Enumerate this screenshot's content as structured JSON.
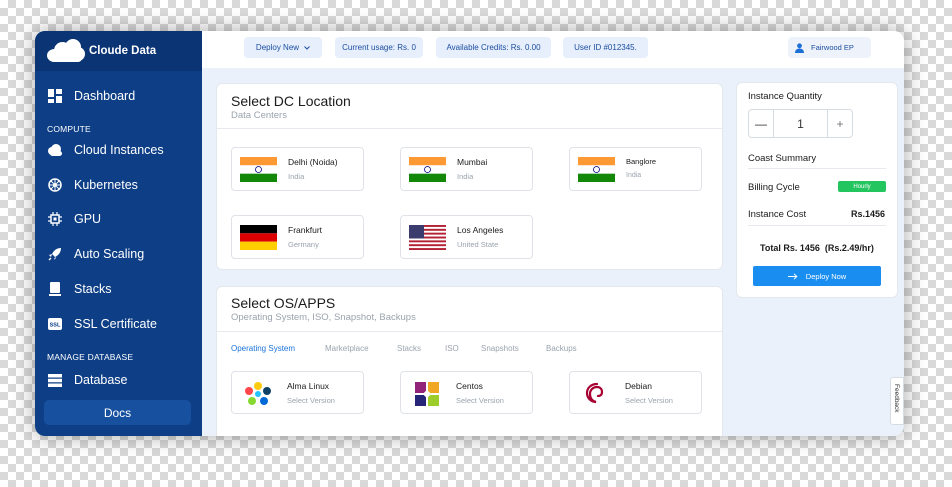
{
  "app": {
    "name": "Cloude Data"
  },
  "sidebar": {
    "items": [
      {
        "label": "Dashboard",
        "icon": "dashboard-icon"
      },
      {
        "label": "Cloud Instances",
        "icon": "cloud-icon"
      },
      {
        "label": "Kubernetes",
        "icon": "kubernetes-icon"
      },
      {
        "label": "GPU",
        "icon": "gpu-icon"
      },
      {
        "label": "Auto Scaling",
        "icon": "rocket-icon"
      },
      {
        "label": "Stacks",
        "icon": "stacks-icon"
      },
      {
        "label": "SSL Certificate",
        "icon": "ssl-icon"
      },
      {
        "label": "Database",
        "icon": "database-icon"
      }
    ],
    "sections": {
      "compute": "COMPUTE",
      "manage_database": "MANAGE DATABASE"
    },
    "docs_label": "Docs"
  },
  "topbar": {
    "deploy_label": "Deploy New",
    "usage": "Current usage: Rs. 0",
    "credits": "Available Credits: Rs. 0.00",
    "user_id": "User ID #012345.",
    "user_name": "Fairwood EP"
  },
  "dc": {
    "title": "Select DC Location",
    "subtitle": "Data Centers",
    "locations": [
      {
        "name": "Delhi (Noida)",
        "country": "India",
        "flag": "india"
      },
      {
        "name": "Mumbai",
        "country": "India",
        "flag": "india"
      },
      {
        "name": "Banglore",
        "country": "India",
        "flag": "india"
      },
      {
        "name": "Frankfurt",
        "country": "Germany",
        "flag": "germany"
      },
      {
        "name": "Los Angeles",
        "country": "United State",
        "flag": "usa"
      }
    ]
  },
  "os": {
    "title": "Select OS/APPS",
    "subtitle": "Operating System, ISO, Snapshot, Backups",
    "tabs": [
      "Operating System",
      "Marketplace",
      "Stacks",
      "ISO",
      "Snapshots",
      "Backups"
    ],
    "active_tab": "Operating System",
    "items": [
      {
        "name": "Alma Linux",
        "version": "Select Version",
        "icon": "alma-linux-icon"
      },
      {
        "name": "Centos",
        "version": "Select Version",
        "icon": "centos-icon"
      },
      {
        "name": "Debian",
        "version": "Select Version",
        "icon": "debian-icon"
      }
    ]
  },
  "summary": {
    "qty_label": "Instance Quantity",
    "qty_value": "1",
    "minus": "—",
    "plus": "+",
    "cost_title": "Coast Summary",
    "billing_label": "Billing Cycle",
    "billing_badge": "Hourly",
    "instance_cost_label": "Instance Cost",
    "instance_cost_value": "Rs.1456",
    "total": "Total Rs. 1456  (Rs.2.49/hr)",
    "deploy_button": "Deploy Now"
  },
  "feedback_label": "Feedback",
  "colors": {
    "sidebar": "#0e3f86",
    "accent": "#1a8ef0",
    "badge": "#22c55e"
  }
}
